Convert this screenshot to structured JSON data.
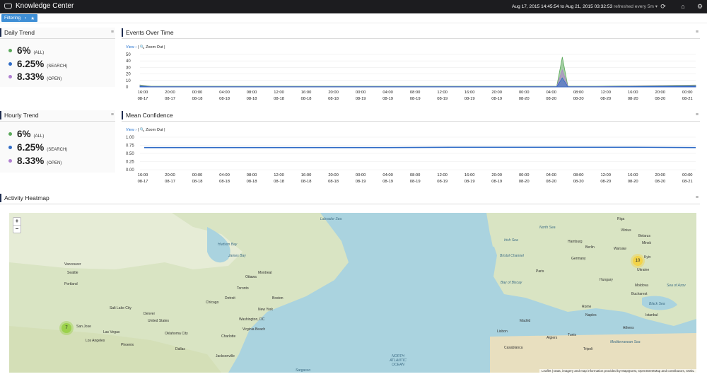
{
  "app": {
    "title": "Knowledge Center",
    "time_range": "Aug 17, 2015 14:45:54 to Aug 21, 2015 03:32:53",
    "refresh": "refreshed every 5m"
  },
  "filter_bar": {
    "label": "Filtering"
  },
  "daily_trend": {
    "title": "Daily Trend",
    "rows": [
      {
        "value": "6%",
        "label": "(ALL)",
        "color": "#5aa85a"
      },
      {
        "value": "6.25%",
        "label": "(SEARCH)",
        "color": "#2f6bc6"
      },
      {
        "value": "8.33%",
        "label": "(OPEN)",
        "color": "#b07fd0"
      }
    ]
  },
  "hourly_trend": {
    "title": "Hourly Trend",
    "rows": [
      {
        "value": "6%",
        "label": "(ALL)",
        "color": "#5aa85a"
      },
      {
        "value": "6.25%",
        "label": "(SEARCH)",
        "color": "#2f6bc6"
      },
      {
        "value": "8.33%",
        "label": "(OPEN)",
        "color": "#b07fd0"
      }
    ]
  },
  "chart_controls": {
    "view": "View",
    "zoom_out": "Zoom Out"
  },
  "x_ticks": [
    {
      "t": "16:00",
      "d": "08-17"
    },
    {
      "t": "20:00",
      "d": "08-17"
    },
    {
      "t": "00:00",
      "d": "08-18"
    },
    {
      "t": "04:00",
      "d": "08-18"
    },
    {
      "t": "08:00",
      "d": "08-18"
    },
    {
      "t": "12:00",
      "d": "08-18"
    },
    {
      "t": "16:00",
      "d": "08-18"
    },
    {
      "t": "20:00",
      "d": "08-18"
    },
    {
      "t": "00:00",
      "d": "08-19"
    },
    {
      "t": "04:00",
      "d": "08-19"
    },
    {
      "t": "08:00",
      "d": "08-19"
    },
    {
      "t": "12:00",
      "d": "08-19"
    },
    {
      "t": "16:00",
      "d": "08-19"
    },
    {
      "t": "20:00",
      "d": "08-19"
    },
    {
      "t": "00:00",
      "d": "08-20"
    },
    {
      "t": "04:00",
      "d": "08-20"
    },
    {
      "t": "08:00",
      "d": "08-20"
    },
    {
      "t": "12:00",
      "d": "08-20"
    },
    {
      "t": "16:00",
      "d": "08-20"
    },
    {
      "t": "20:00",
      "d": "08-20"
    },
    {
      "t": "00:00",
      "d": "08-21"
    }
  ],
  "chart_data": [
    {
      "type": "area",
      "title": "Events Over Time",
      "xlabel": "",
      "ylabel": "",
      "ylim": [
        0,
        50
      ],
      "yticks": [
        "50",
        "40",
        "30",
        "20",
        "10",
        "0"
      ],
      "x": [
        0,
        2,
        20,
        40,
        70,
        75,
        76,
        77,
        82,
        100
      ],
      "x_note": "time position along axis 16:00 08-17 .. 00:00 08-21",
      "series": [
        {
          "name": "",
          "color": "#5aa85a",
          "values": [
            3,
            1,
            1,
            1,
            1,
            1,
            46,
            1,
            1,
            3
          ]
        },
        {
          "name": "",
          "color": "#b07fd0",
          "values": [
            2,
            0.5,
            0.5,
            0.5,
            0.5,
            0.5,
            26,
            0.5,
            0.5,
            2
          ]
        },
        {
          "name": "",
          "color": "#2f6bc6",
          "values": [
            1,
            0.3,
            0.3,
            0.3,
            0.3,
            0.3,
            14,
            0.3,
            0.3,
            1
          ]
        }
      ],
      "grid": true
    },
    {
      "type": "line",
      "title": "Mean Confidence",
      "xlabel": "",
      "ylabel": "",
      "ylim": [
        0,
        1
      ],
      "yticks": [
        "1.00",
        "0.75",
        "0.50",
        "0.25",
        "0.00"
      ],
      "series": [
        {
          "name": "",
          "color": "#2f6bc6",
          "values": [
            0.68,
            0.68,
            0.68,
            0.68,
            0.68,
            0.69,
            0.69,
            0.69,
            0.69,
            0.68
          ]
        }
      ],
      "grid": true
    }
  ],
  "heatmap": {
    "title": "Activity Heatmap",
    "zoom_in": "+",
    "zoom_out": "−",
    "clusters": [
      {
        "count": "7",
        "color": "#9bd14b"
      },
      {
        "count": "10",
        "color": "#f2d34a"
      }
    ],
    "labels": [
      "Labrador Sea",
      "Hudson Bay",
      "James Bay",
      "Vancouver",
      "Seattle",
      "Portland",
      "Salt Lake City",
      "San Jose",
      "Los Angeles",
      "Las Vegas",
      "Phoenix",
      "Denver",
      "United States",
      "Oklahoma City",
      "Dallas",
      "Chicago",
      "Detroit",
      "Toronto",
      "Ottawa",
      "Montreal",
      "Boston",
      "New York",
      "Washington, DC",
      "Virginia Beach",
      "Charlotte",
      "Jacksonville",
      "Sargasso",
      "NORTH ATLANTIC OCEAN",
      "Bay of Biscay",
      "North Sea",
      "Irish Sea",
      "Bristol Channel",
      "Hamburg",
      "Berlin",
      "Warsaw",
      "Kyiv",
      "Ukraine",
      "Germany",
      "Paris",
      "Madrid",
      "Lisbon",
      "Rome",
      "Naples",
      "Tunis",
      "Algiers",
      "Tripoli",
      "Casablanca",
      "Mediterranean Sea",
      "Black Sea",
      "Sea of Azov",
      "Istanbul",
      "Athens",
      "Hungary",
      "Moldova",
      "Belarus",
      "Minsk",
      "Vilnius",
      "Riga",
      "Bucharest"
    ],
    "attribution": "Leaflet | Data, imagery and map information provided by MapQuest, OpenStreetMap and contributors, ODbL"
  }
}
